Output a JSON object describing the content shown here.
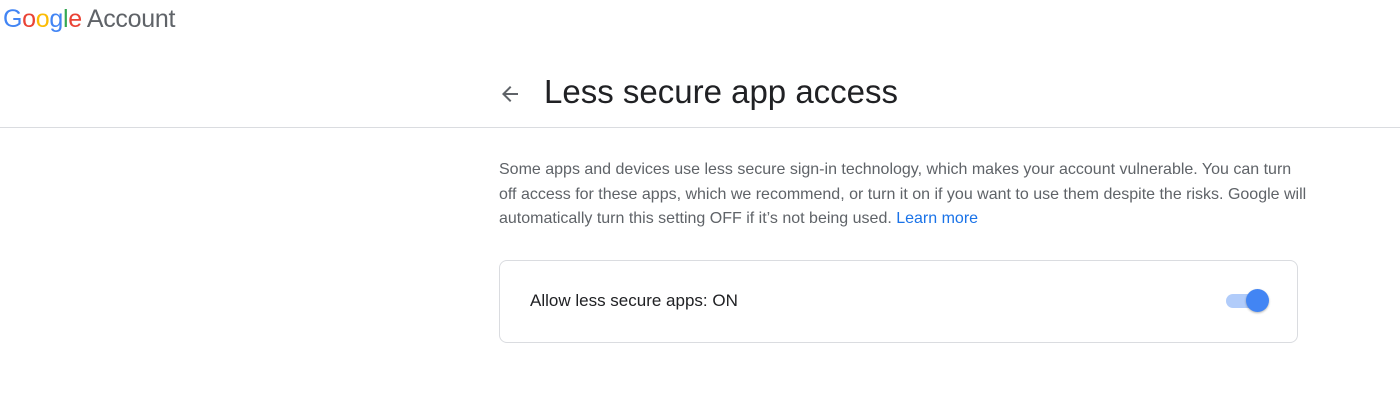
{
  "brand": {
    "logo_letters": [
      {
        "char": "G",
        "color": "#4285F4"
      },
      {
        "char": "o",
        "color": "#EA4335"
      },
      {
        "char": "o",
        "color": "#FBBC05"
      },
      {
        "char": "g",
        "color": "#4285F4"
      },
      {
        "char": "l",
        "color": "#34A853"
      },
      {
        "char": "e",
        "color": "#EA4335"
      }
    ],
    "product": "Account"
  },
  "header": {
    "back_icon": "arrow-back-icon",
    "title": "Less secure app access"
  },
  "main": {
    "description": "Some apps and devices use less secure sign-in technology, which makes your account vulnerable. You can turn off access for these apps, which we recommend, or turn it on if you want to use them despite the risks. Google will automatically turn this setting OFF if it’s not being used.",
    "learn_more": "Learn more",
    "setting": {
      "label": "Allow less secure apps: ON",
      "toggle_state": "on",
      "toggle_color": "#4285F4"
    }
  }
}
